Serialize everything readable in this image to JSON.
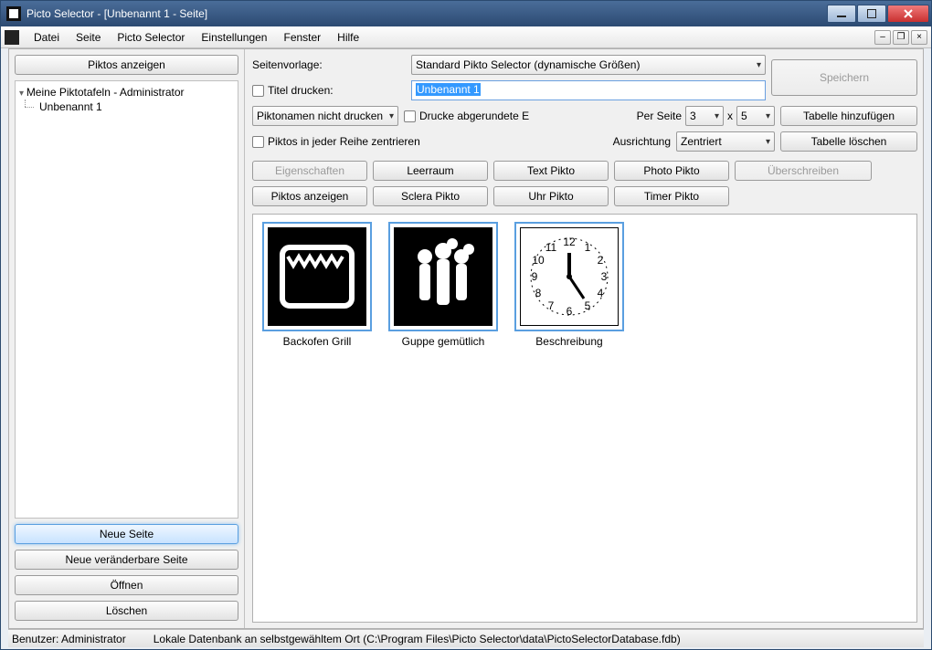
{
  "window": {
    "title": "Picto Selector - [Unbenannt 1 - Seite]"
  },
  "menu": {
    "items": [
      "Datei",
      "Seite",
      "Picto Selector",
      "Einstellungen",
      "Fenster",
      "Hilfe"
    ]
  },
  "left": {
    "show_piktos": "Piktos anzeigen",
    "tree_root": "Meine Piktotafeln - Administrator",
    "tree_child": "Unbenannt 1",
    "neue_seite": "Neue Seite",
    "neue_veraenderbare": "Neue veränderbare Seite",
    "oeffnen": "Öffnen",
    "loeschen": "Löschen"
  },
  "form": {
    "seitenvorlage_label": "Seitenvorlage:",
    "seitenvorlage_value": "Standard Pikto Selector (dynamische Größen)",
    "titel_drucken": "Titel drucken:",
    "titel_value": "Unbenannt 1",
    "speichern": "Speichern",
    "piktonamen": "Piktonamen nicht drucken",
    "drucke_abgerundet": "Drucke abgerundete E",
    "per_seite_label": "Per Seite",
    "per_seite_w": "3",
    "per_seite_x": "x",
    "per_seite_h": "5",
    "tabelle_hinzufuegen": "Tabelle hinzufügen",
    "zentrieren": "Piktos in jeder Reihe zentrieren",
    "ausrichtung_label": "Ausrichtung",
    "ausrichtung_value": "Zentriert",
    "tabelle_loeschen": "Tabelle löschen",
    "eigenschaften": "Eigenschaften",
    "leerraum": "Leerraum",
    "text_pikto": "Text Pikto",
    "photo_pikto": "Photo Pikto",
    "ueberschreiben": "Überschreiben",
    "piktos_anzeigen": "Piktos anzeigen",
    "sclera_pikto": "Sclera Pikto",
    "uhr_pikto": "Uhr Pikto",
    "timer_pikto": "Timer Pikto"
  },
  "pictos": [
    {
      "label": "Backofen Grill",
      "type": "oven"
    },
    {
      "label": "Guppe gemütlich",
      "type": "group"
    },
    {
      "label": "Beschreibung",
      "type": "clock"
    }
  ],
  "status": {
    "user": "Benutzer: Administrator",
    "db": "Lokale Datenbank an selbstgewähltem Ort (C:\\Program Files\\Picto Selector\\data\\PictoSelectorDatabase.fdb)"
  }
}
